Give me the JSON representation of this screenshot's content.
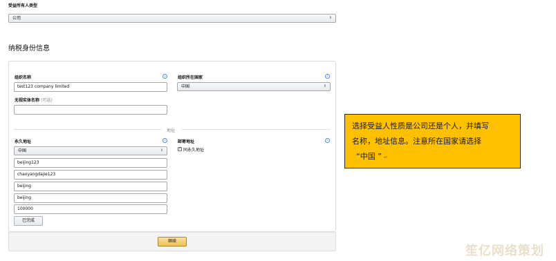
{
  "owner": {
    "label": "受益所有人类型",
    "value": "公司"
  },
  "section_title": "纳税身份信息",
  "form": {
    "org_name_label": "组织名称",
    "org_name_value": "test123 company limited",
    "country_label": "组织所在国家",
    "country_value": "中国",
    "disregarded_label": "无视实体名称",
    "disregarded_optional": "(可选)",
    "disregarded_value": "",
    "address_divider": "地址",
    "permanent_label": "永久地址",
    "permanent_country": "中国",
    "address_lines": [
      "beijing123",
      "chaoyangdajie123",
      "beijing",
      "beijing",
      "100000"
    ],
    "done_button": "已完成",
    "mailing_label": "邮寄地址",
    "same_as_permanent": "同永久地址",
    "continue_button": "继续"
  },
  "callout": {
    "lines": [
      "选择受益人性质是公司还是个人，并填写",
      "名称，地址信息。注意所在国家请选择",
      "“中国 ”"
    ],
    "return_mark": "↵"
  },
  "watermark": "笙亿网络策划",
  "icons": {
    "info": "i",
    "select_arrow": "⇕",
    "check": "✓"
  }
}
